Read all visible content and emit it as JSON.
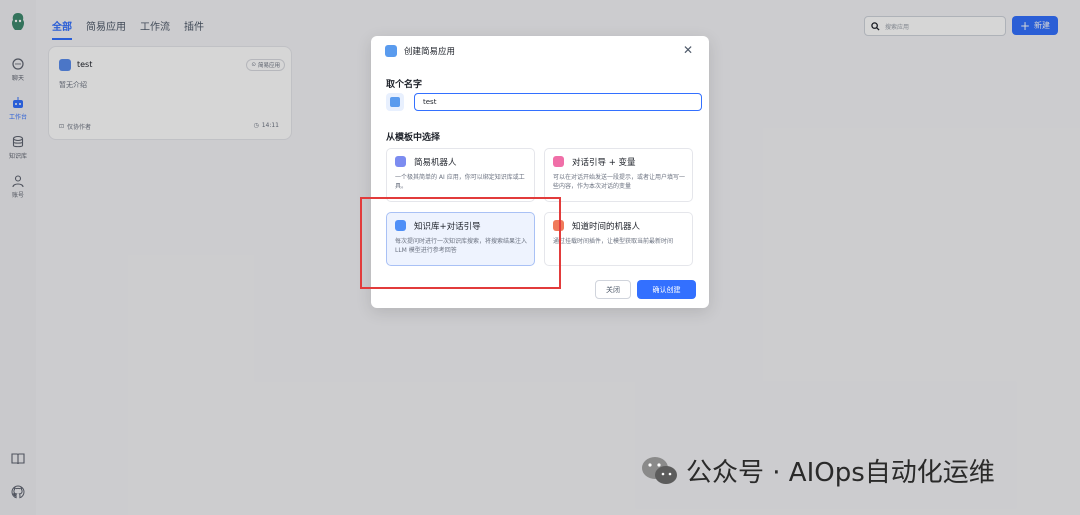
{
  "sidebar": {
    "items": [
      {
        "label": "聊天",
        "icon": "chat-icon"
      },
      {
        "label": "工作台",
        "icon": "robot-icon"
      },
      {
        "label": "知识库",
        "icon": "database-icon"
      },
      {
        "label": "账号",
        "icon": "user-icon"
      }
    ],
    "bottom_icons": [
      "book-icon",
      "github-icon"
    ]
  },
  "tabs": [
    "全部",
    "简易应用",
    "工作流",
    "插件"
  ],
  "search": {
    "placeholder": "搜索应用"
  },
  "new_button": {
    "label": "新建"
  },
  "app_card": {
    "name": "test",
    "badge": "简易应用",
    "description": "暂无介绍",
    "author": "仅协作者",
    "time": "14:11"
  },
  "modal": {
    "title": "创建简易应用",
    "name_label": "取个名字",
    "name_value": "test",
    "template_label": "从模板中选择",
    "templates": [
      {
        "name": "简易机器人",
        "desc": "一个极其简单的 AI 应用，你可以绑定知识库或工具。",
        "color": "#7c8cf0"
      },
      {
        "name": "对话引导 + 变量",
        "desc": "可以在对话开始发送一段提示，或者让用户填写一些内容，作为本次对话的变量",
        "color": "#f06fa8"
      },
      {
        "name": "知识库+对话引导",
        "desc": "每次提问时进行一次知识库搜索，将搜索结果注入 LLM 模型进行参考回答",
        "color": "#4f8ff7"
      },
      {
        "name": "知道时间的机器人",
        "desc": "通过挂载时间插件，让模型获取当前最新时间",
        "color": "#f07a5a"
      }
    ],
    "cancel_label": "关闭",
    "confirm_label": "确认创建"
  },
  "watermark": "公众号 · AIOps自动化运维"
}
